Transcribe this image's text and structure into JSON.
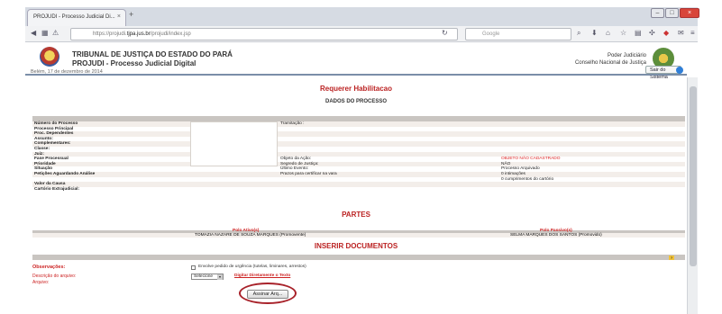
{
  "browser": {
    "tab_title": "PROJUDI - Processo Judicial Di...",
    "tab_close": "×",
    "new_tab": "+",
    "url_prefix": "https://projudi.",
    "url_domain": "tjpa.jus.br",
    "url_path": "/projudi/index.jsp",
    "search_placeholder": "Google",
    "win_min": "–",
    "win_max": "□",
    "win_close": "×"
  },
  "header": {
    "court_name": "TRIBUNAL DE JUSTIÇA DO ESTADO DO PARÁ",
    "system_name": "PROJUDI - Processo Judicial Digital",
    "date": "Belém, 17 de dezembro de 2014",
    "poder_line1": "Poder Judiciário",
    "poder_line2": "Conselho Nacional de Justiça",
    "exit_label": "Sair do Sistema"
  },
  "page": {
    "title": "Requerer Habilitacao",
    "dados_title": "DADOS DO PROCESSO",
    "partes_title": "PARTES",
    "inserir_title": "INSERIR DOCUMENTOS"
  },
  "process_rows": [
    {
      "label": "Número do Processo",
      "mid": "Tramitação :",
      "val": ""
    },
    {
      "label": "Processo Principal",
      "mid": "",
      "val": ""
    },
    {
      "label": "Proc. Dependentes",
      "mid": "",
      "val": ""
    },
    {
      "label": "Assunto:",
      "mid": "",
      "val": ""
    },
    {
      "label": "Complementares:",
      "mid": "",
      "val": ""
    },
    {
      "label": "Classe:",
      "mid": "",
      "val": ""
    },
    {
      "label": "Juiz:",
      "mid": "",
      "val": ""
    },
    {
      "label": "Fase Processual",
      "mid": "Objeto da Ação:",
      "val": "OBJETO NÃO CADASTRADO"
    },
    {
      "label": "Prioridade",
      "mid": "Segredo de Justiça:",
      "val": "NÃO"
    },
    {
      "label": "Situação",
      "mid": "Último Evento:",
      "val": "Processo Arquivado"
    },
    {
      "label": "Petições Aguardando Análise",
      "mid": "Prazos para certificar na vara",
      "val": "0 intimações"
    },
    {
      "label": "",
      "mid": "",
      "val": "0 cumprimentos do cartório"
    },
    {
      "label": "Valor da Causa",
      "mid": "",
      "val": ""
    },
    {
      "label": "Cartório Extrajudicial:",
      "mid": "",
      "val": ""
    }
  ],
  "partes": {
    "ativo_header": "Polo Ativo(s)",
    "passivo_header": "Polo Passivo(s)",
    "ativo_name": "TOMAZIA NAZARE DE SOUZA MARQUES  (Promovente)",
    "passivo_name": "SELMA MARQUES DOS SANTOS  (Promovido)"
  },
  "documentos": {
    "help": "?",
    "observacoes_label": "Observações:",
    "urgencia_label": "Envolve pedido de urgência (tutelas, liminares, arrestos)",
    "descricao_label": "Descrição do arquivo:",
    "select_value": "Selecione",
    "select_arrow": "▾",
    "digitar_link": "Digitar Diretamente o Texto",
    "arquivo_label": "Arquivo:",
    "assinar_button": "Assinar Arq..."
  }
}
